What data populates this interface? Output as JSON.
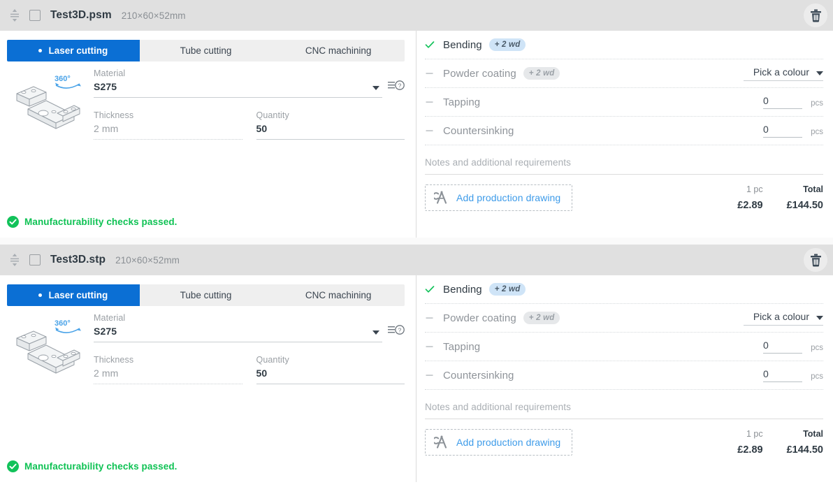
{
  "theme": {
    "accent_blue": "#0b6fd4",
    "link_blue": "#3d9be9",
    "success_green": "#12c25a",
    "header_grey": "#e0e0e0",
    "muted_grey": "#9a9fa4"
  },
  "cards": [
    {
      "file_name": "Test3D.psm",
      "dimensions": "210×60×52mm",
      "drag_handle_icon": "drag-handle-icon",
      "checkbox_checked": false,
      "delete_icon": "trash-icon",
      "tabs": [
        {
          "label": "Laser cutting",
          "active": true
        },
        {
          "label": "Tube cutting",
          "active": false
        },
        {
          "label": "CNC machining",
          "active": false
        }
      ],
      "viewer": {
        "badge": "360°",
        "icon": "rotate-360-icon",
        "part_icon": "3d-part-thumbnail"
      },
      "fields": {
        "material": {
          "label": "Material",
          "value": "S275",
          "enabled": true,
          "help_icon": "material-help-icon",
          "caret_icon": "chevron-down-icon"
        },
        "thickness": {
          "label": "Thickness",
          "value": "2 mm",
          "enabled": false
        },
        "quantity": {
          "label": "Quantity",
          "value": "50",
          "enabled": true
        }
      },
      "manufacturability": {
        "icon": "check-circle-icon",
        "text": "Manufacturability checks passed."
      },
      "operations": [
        {
          "name": "Bending",
          "enabled": true,
          "mark": "✓",
          "badge": "+ 2 wd",
          "control": "none"
        },
        {
          "name": "Powder coating",
          "enabled": false,
          "mark": "–",
          "badge": "+ 2 wd",
          "control": "colour",
          "colour_label": "Pick a colour"
        },
        {
          "name": "Tapping",
          "enabled": false,
          "mark": "–",
          "badge": "",
          "control": "number",
          "value": "0",
          "unit": "pcs"
        },
        {
          "name": "Countersinking",
          "enabled": false,
          "mark": "–",
          "badge": "",
          "control": "number",
          "value": "0",
          "unit": "pcs"
        }
      ],
      "notes_placeholder": "Notes and additional requirements",
      "add_drawing": {
        "label": "Add production drawing",
        "icon": "drafting-compass-icon"
      },
      "totals": {
        "unit_label": "1 pc",
        "unit_price": "£2.89",
        "total_label": "Total",
        "total_price": "£144.50"
      }
    },
    {
      "file_name": "Test3D.stp",
      "dimensions": "210×60×52mm",
      "drag_handle_icon": "drag-handle-icon",
      "checkbox_checked": false,
      "delete_icon": "trash-icon",
      "tabs": [
        {
          "label": "Laser cutting",
          "active": true
        },
        {
          "label": "Tube cutting",
          "active": false
        },
        {
          "label": "CNC machining",
          "active": false
        }
      ],
      "viewer": {
        "badge": "360°",
        "icon": "rotate-360-icon",
        "part_icon": "3d-part-thumbnail"
      },
      "fields": {
        "material": {
          "label": "Material",
          "value": "S275",
          "enabled": true,
          "help_icon": "material-help-icon",
          "caret_icon": "chevron-down-icon"
        },
        "thickness": {
          "label": "Thickness",
          "value": "2 mm",
          "enabled": false
        },
        "quantity": {
          "label": "Quantity",
          "value": "50",
          "enabled": true
        }
      },
      "manufacturability": {
        "icon": "check-circle-icon",
        "text": "Manufacturability checks passed."
      },
      "operations": [
        {
          "name": "Bending",
          "enabled": true,
          "mark": "✓",
          "badge": "+ 2 wd",
          "control": "none"
        },
        {
          "name": "Powder coating",
          "enabled": false,
          "mark": "–",
          "badge": "+ 2 wd",
          "control": "colour",
          "colour_label": "Pick a colour"
        },
        {
          "name": "Tapping",
          "enabled": false,
          "mark": "–",
          "badge": "",
          "control": "number",
          "value": "0",
          "unit": "pcs"
        },
        {
          "name": "Countersinking",
          "enabled": false,
          "mark": "–",
          "badge": "",
          "control": "number",
          "value": "0",
          "unit": "pcs"
        }
      ],
      "notes_placeholder": "Notes and additional requirements",
      "add_drawing": {
        "label": "Add production drawing",
        "icon": "drafting-compass-icon"
      },
      "totals": {
        "unit_label": "1 pc",
        "unit_price": "£2.89",
        "total_label": "Total",
        "total_price": "£144.50"
      }
    }
  ]
}
